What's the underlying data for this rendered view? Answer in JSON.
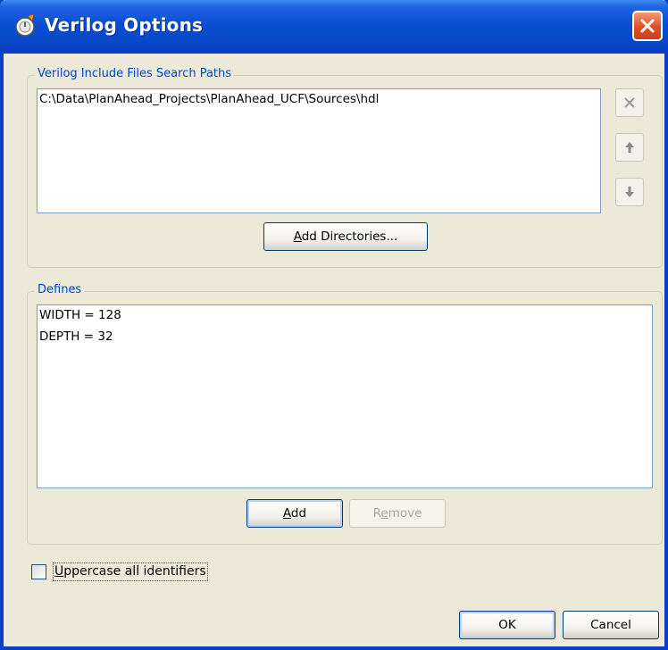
{
  "window": {
    "title": "Verilog Options",
    "close_icon": "close-icon"
  },
  "include_paths": {
    "legend": "Verilog Include Files Search Paths",
    "items": [
      "C:\\Data\\PlanAhead_Projects\\PlanAhead_UCF\\Sources\\hdl"
    ],
    "add_button": {
      "pre": "",
      "mnemonic": "A",
      "post": "dd Directories..."
    }
  },
  "defines": {
    "legend": "Defines",
    "items": [
      "WIDTH = 128",
      "DEPTH = 32"
    ],
    "add_button": {
      "pre": "",
      "mnemonic": "A",
      "post": "dd"
    },
    "remove_button": {
      "pre": "R",
      "mnemonic": "e",
      "post": "move"
    }
  },
  "uppercase": {
    "pre": "",
    "mnemonic": "U",
    "post": "ppercase all identifiers",
    "checked": false
  },
  "footer": {
    "ok_label": "OK",
    "cancel_label": "Cancel"
  },
  "colors": {
    "legend": "#0046d5",
    "title_bar": "#0a4ed4",
    "close": "#e04f24"
  }
}
